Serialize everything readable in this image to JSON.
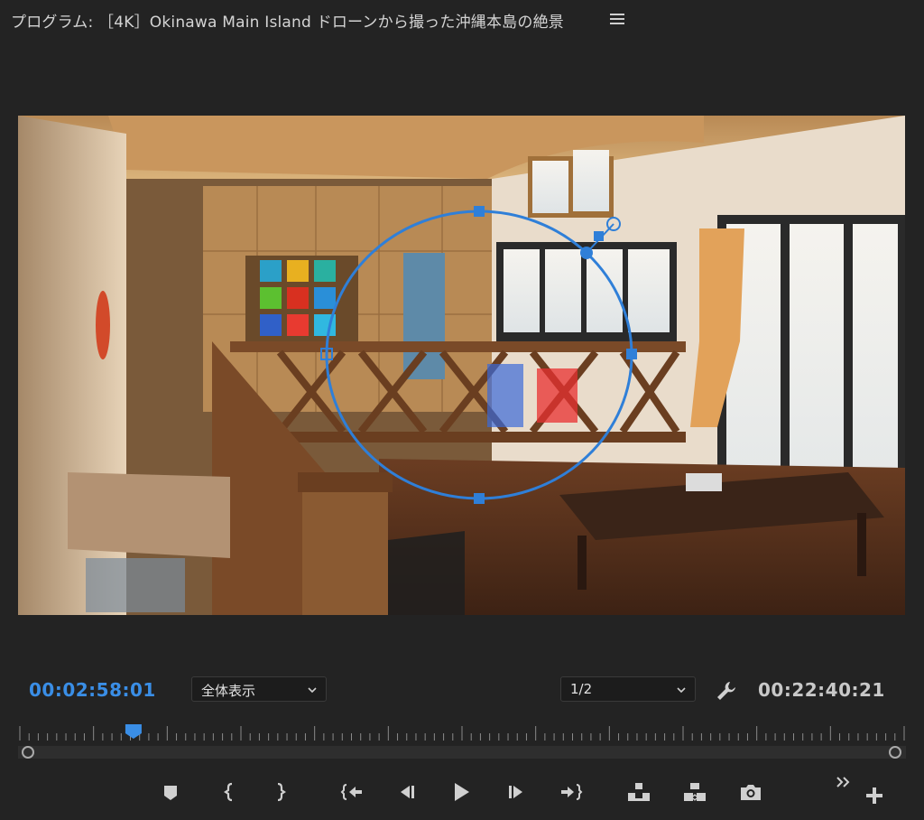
{
  "panel": {
    "title": "プログラム: ［4K］Okinawa Main Island ドローンから撮った沖縄本島の絶景"
  },
  "timecode": {
    "current": "00:02:58:01",
    "duration": "00:22:40:21"
  },
  "zoom": {
    "selected": "全体表示"
  },
  "resolution": {
    "selected": "1/2"
  },
  "playhead": {
    "position_fraction": 0.13
  },
  "transport_buttons": [
    {
      "name": "add-marker-icon"
    },
    {
      "name": "mark-in-icon"
    },
    {
      "name": "mark-out-icon"
    },
    {
      "name": "go-to-in-icon"
    },
    {
      "name": "step-back-icon"
    },
    {
      "name": "play-icon"
    },
    {
      "name": "step-forward-icon"
    },
    {
      "name": "go-to-out-icon"
    },
    {
      "name": "lift-icon"
    },
    {
      "name": "extract-icon"
    },
    {
      "name": "export-frame-icon"
    }
  ],
  "colors": {
    "accent": "#3a8ee6",
    "background": "#232323",
    "mask_stroke": "#2f7fd8"
  }
}
